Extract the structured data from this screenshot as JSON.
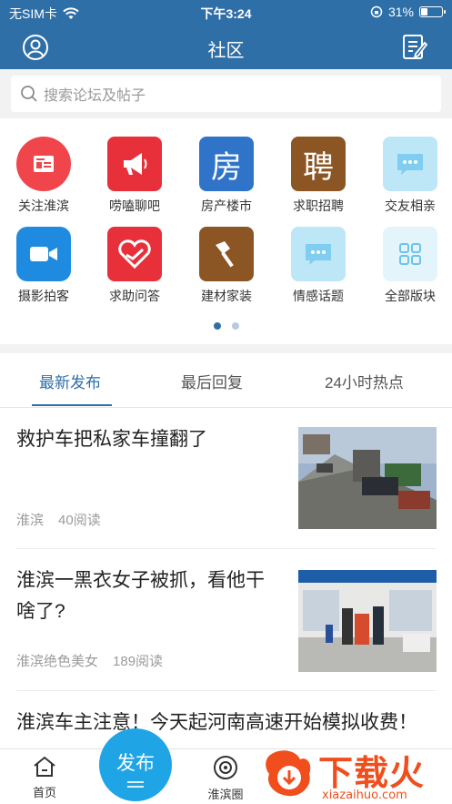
{
  "status_bar": {
    "carrier": "无SIM卡",
    "time": "下午3:24",
    "battery": "31%",
    "battery_level": 0.31
  },
  "header": {
    "title": "社区"
  },
  "search": {
    "placeholder": "搜索论坛及帖子"
  },
  "categories": [
    {
      "label": "关注淮滨",
      "icon": "news-icon",
      "color": "#f0454b"
    },
    {
      "label": "唠嗑聊吧",
      "icon": "megaphone-icon",
      "color": "#e8303b"
    },
    {
      "label": "房产楼市",
      "icon": "house-char-icon",
      "glyph": "房",
      "color": "#2f74c8"
    },
    {
      "label": "求职招聘",
      "icon": "hire-char-icon",
      "glyph": "聘",
      "color": "#8b5524"
    },
    {
      "label": "交友相亲",
      "icon": "chat-icon",
      "color": "#bde6f7"
    },
    {
      "label": "摄影拍客",
      "icon": "video-camera-icon",
      "color": "#1f8be0"
    },
    {
      "label": "求助问答",
      "icon": "heart-icon",
      "color": "#e8303b"
    },
    {
      "label": "建材家装",
      "icon": "brush-icon",
      "color": "#8b5524"
    },
    {
      "label": "情感话题",
      "icon": "chat-icon",
      "color": "#bde6f7"
    },
    {
      "label": "全部版块",
      "icon": "grid-icon",
      "color": "#e4f4fb"
    }
  ],
  "page_indicator": {
    "count": 2,
    "active": 0
  },
  "tabs": [
    {
      "label": "最新发布",
      "active": true
    },
    {
      "label": "最后回复",
      "active": false
    },
    {
      "label": "24小时热点",
      "active": false
    }
  ],
  "posts": [
    {
      "title": "救护车把私家车撞翻了",
      "author": "淮滨",
      "reads": "40阅读"
    },
    {
      "title": "淮滨一黑衣女子被抓，看他干啥了?",
      "author": "淮滨绝色美女",
      "reads": "189阅读"
    },
    {
      "title": "淮滨车主注意！今天起河南高速开始模拟收费！"
    }
  ],
  "bottom_nav": {
    "home": "首页",
    "publish": "发布",
    "circle": "淮滨圈"
  },
  "watermark": {
    "text": "下载火",
    "url": "xiazaihuo.com"
  },
  "colors": {
    "primary": "#2f6fa7",
    "publish": "#1fa4e6",
    "watermark": "#f04e1d"
  }
}
